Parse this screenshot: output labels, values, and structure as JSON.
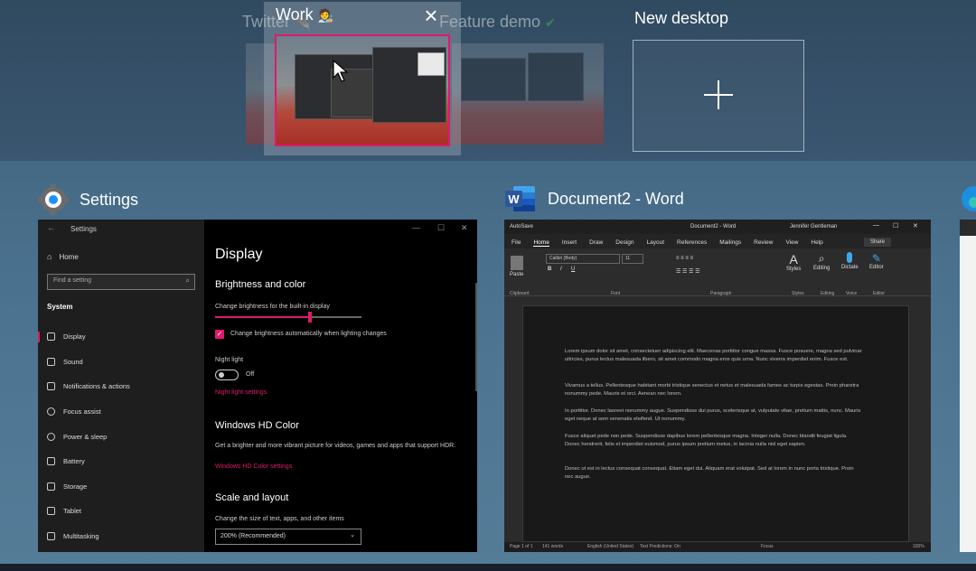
{
  "desktops": [
    {
      "label": "Twitter",
      "emoji": "🪶"
    },
    {
      "label": "Work",
      "emoji": "🧑‍🎨"
    },
    {
      "label": "Feature demo",
      "emoji": "✔"
    },
    {
      "label": "New desktop"
    }
  ],
  "close_glyph": "×",
  "windows": {
    "settings": {
      "app_title": "Settings",
      "window_title": "Settings",
      "home": "Home",
      "search_placeholder": "Find a setting",
      "section": "System",
      "nav": [
        "Display",
        "Sound",
        "Notifications & actions",
        "Focus assist",
        "Power & sleep",
        "Battery",
        "Storage",
        "Tablet",
        "Multitasking"
      ],
      "active_nav": "Display",
      "heading": "Display",
      "brightness_heading": "Brightness and color",
      "brightness_label": "Change brightness for the built-in display",
      "brightness_level": 0.65,
      "auto_brightness_label": "Change brightness automatically when lighting changes",
      "night_light_label": "Night light",
      "night_light_state": "Off",
      "night_light_link": "Night light settings",
      "hd_heading": "Windows HD Color",
      "hd_text": "Get a brighter and more vibrant picture for videos, games and apps that support HDR.",
      "hd_link": "Windows HD Color settings",
      "scale_heading": "Scale and layout",
      "scale_label": "Change the size of text, apps, and other items",
      "scale_value": "200% (Recommended)"
    },
    "word": {
      "app_title": "Document2 - Word",
      "title_left": "AutoSave",
      "title_center": "Document2 - Word",
      "user": "Jennifer Gentleman",
      "menu": [
        "File",
        "Home",
        "Insert",
        "Draw",
        "Design",
        "Layout",
        "References",
        "Mailings",
        "Review",
        "View",
        "Help"
      ],
      "active_menu": "Home",
      "share": "Share",
      "font_name": "Calibri (Body)",
      "font_size": "11",
      "groups": [
        "Clipboard",
        "Font",
        "Paragraph",
        "Styles",
        "Editing",
        "Voice",
        "Editor"
      ],
      "tools": [
        "Paste",
        "Styles",
        "Editing",
        "Dictate",
        "Editor"
      ],
      "paragraphs": [
        "Lorem ipsum dolor sit amet, consectetuer adipiscing elit. Maecenas porttitor congue massa. Fusce posuere, magna sed pulvinar ultricies, purus lectus malesuada libero, sit amet commodo magna eros quis urna. Nunc viverra imperdiet enim. Fusce est.",
        "Vivamus a tellus. Pellentesque habitant morbi tristique senectus et netus et malesuada fames ac turpis egestas. Proin pharetra nonummy pede. Mauris et orci. Aenean nec lorem.",
        "In porttitor. Donec laoreet nonummy augue. Suspendisse dui purus, scelerisque at, vulputate vitae, pretium mattis, nunc. Mauris eget neque at sem venenatis eleifend. Ut nonummy.",
        "Fusce aliquet pede non pede. Suspendisse dapibus lorem pellentesque magna. Integer nulla. Donec blandit feugiat ligula. Donec hendrerit, felis et imperdiet euismod, purus ipsum pretium metus, in lacinia nulla nisl eget sapien.",
        "Donec ut est in lectus consequat consequat. Etiam eget dui. Aliquam erat volutpat. Sed at lorem in nunc porta tristique. Proin nec augue."
      ],
      "status": {
        "page": "Page 1 of 1",
        "words": "141 words",
        "lang": "English (United States)",
        "predictions": "Text Predictions: On",
        "focus": "Focus",
        "zoom": "100%"
      }
    }
  },
  "colors": {
    "accent": "#e0196b",
    "word_blue": "#2b579a",
    "settings_gray": "#6b6b6b"
  }
}
